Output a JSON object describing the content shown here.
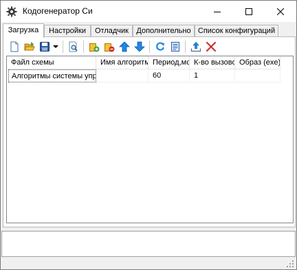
{
  "window": {
    "title": "Кодогенератор Си",
    "controls": {
      "minimize": "minimize",
      "maximize": "maximize",
      "close": "close"
    }
  },
  "tabs": [
    {
      "label": "Загрузка",
      "active": true
    },
    {
      "label": "Настройки",
      "active": false
    },
    {
      "label": "Отладчик",
      "active": false
    },
    {
      "label": "Дополнительно",
      "active": false
    },
    {
      "label": "Список конфигураций",
      "active": false
    }
  ],
  "toolbar": {
    "buttons": [
      {
        "name": "new-file",
        "icon": "new-document-icon"
      },
      {
        "name": "open",
        "icon": "open-folder-icon"
      },
      {
        "name": "save",
        "icon": "floppy-disk-icon"
      },
      {
        "name": "save-dropdown",
        "icon": "dropdown-arrow-icon"
      },
      {
        "name": "preview",
        "icon": "magnifier-page-icon"
      },
      {
        "name": "add",
        "icon": "add-item-icon"
      },
      {
        "name": "remove",
        "icon": "remove-item-icon"
      },
      {
        "name": "move-up",
        "icon": "arrow-up-icon"
      },
      {
        "name": "move-down",
        "icon": "arrow-down-icon"
      },
      {
        "name": "refresh",
        "icon": "refresh-icon"
      },
      {
        "name": "list",
        "icon": "list-icon"
      },
      {
        "name": "export",
        "icon": "export-icon"
      },
      {
        "name": "delete",
        "icon": "delete-x-icon"
      }
    ]
  },
  "table": {
    "columns": [
      "Файл схемы",
      "Имя алгоритма",
      "Период,мс",
      "К-во вызовов",
      "Образ (exe)"
    ],
    "rows": [
      [
        "Алгоритмы системы управления",
        "",
        "60",
        "1",
        ""
      ]
    ]
  },
  "colors": {
    "titlebar": "#ffffff",
    "window_bg": "#f0f0f0",
    "accent_blue": "#1e88e5",
    "delete_red": "#d32f2f",
    "add_green": "#43a047",
    "folder_yellow": "#f4c430"
  }
}
